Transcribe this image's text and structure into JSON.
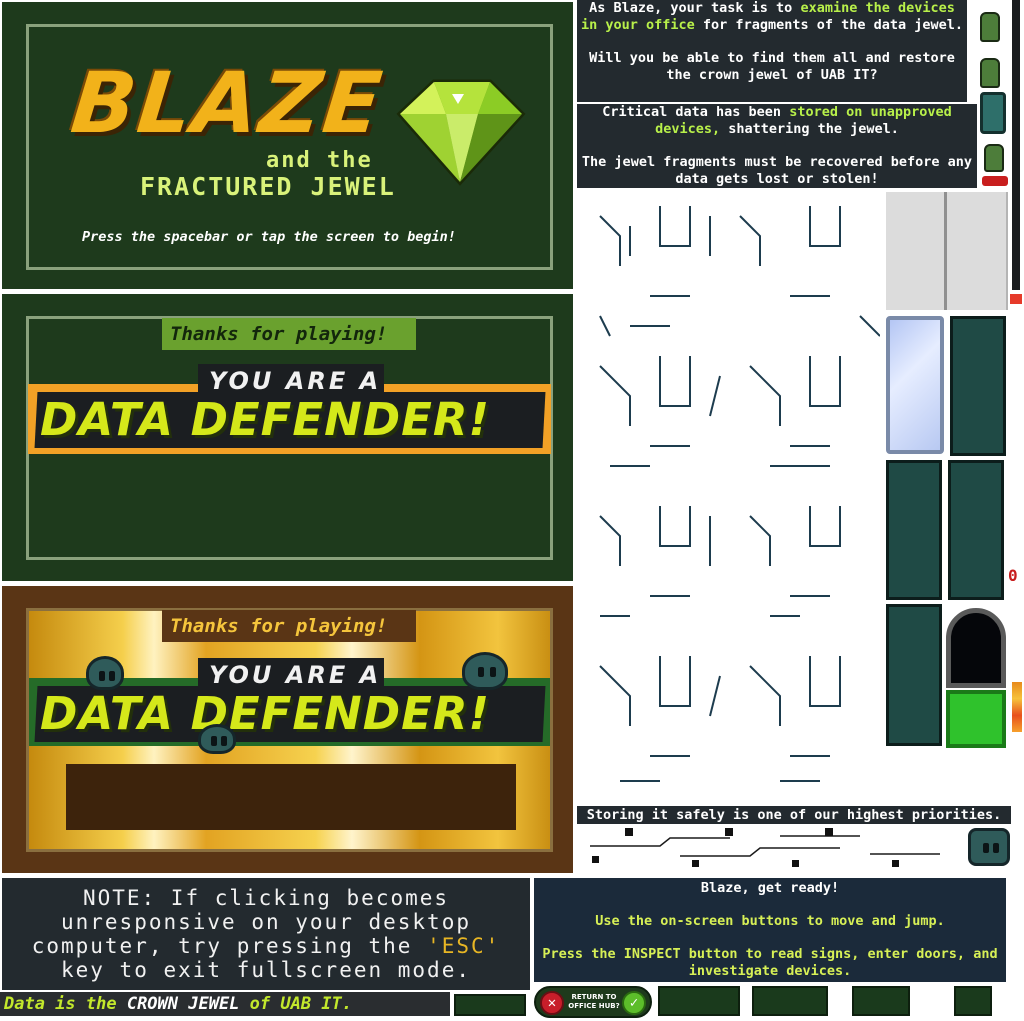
{
  "title_screen": {
    "logo": "BLAZE",
    "subtitle_line1": "and the",
    "subtitle_line2": "FRACTURED JEWEL",
    "prompt": "Press the spacebar or tap the screen to begin!"
  },
  "end_screen_green": {
    "thanks": "Thanks for playing!",
    "line1": "YOU ARE A",
    "line2": "DATA DEFENDER!"
  },
  "end_screen_gold": {
    "thanks": "Thanks for playing!",
    "line1": "YOU ARE A",
    "line2": "DATA DEFENDER!"
  },
  "intro_box": {
    "part1": "As Blaze, your task is to ",
    "highlight1": "examine the devices in your office",
    "part2": " for fragments of the data jewel.",
    "question": "Will you be able to find them all and restore the crown jewel of UAB IT?"
  },
  "critical_box": {
    "part1": "Critical data has been ",
    "highlight": "stored on unapproved devices,",
    "part2": " shattering the jewel.",
    "line2": "The jewel fragments must be recovered before any data gets lost or stolen!"
  },
  "storing_banner": "Storing it safely is one of our highest priorities.",
  "note_box": {
    "prefix": "NOTE: If clicking becomes unresponsive on your desktop computer, try pressing the ",
    "key": "'ESC'",
    "suffix": " key to exit fullscreen mode."
  },
  "ready_box": {
    "line1": "Blaze, get ready!",
    "line2": "Use the on-screen buttons to move and jump.",
    "line3": "Press the INSPECT button to read signs, enter doors, and investigate devices."
  },
  "footer_banner": {
    "part1": "Data is the ",
    "highlight": "CROWN JEWEL",
    "part2": " of UAB IT."
  },
  "return_prompt": {
    "label": "RETURN TO OFFICE HUB?",
    "cancel_icon": "x-icon",
    "confirm_icon": "check-icon"
  },
  "counter_digit": "0",
  "colors": {
    "panel_green": "#1e3a1c",
    "lime_text": "#d9f27a",
    "gold": "#f2b21a",
    "dark_box": "#232a2f",
    "brown_panel": "#5a3515"
  }
}
